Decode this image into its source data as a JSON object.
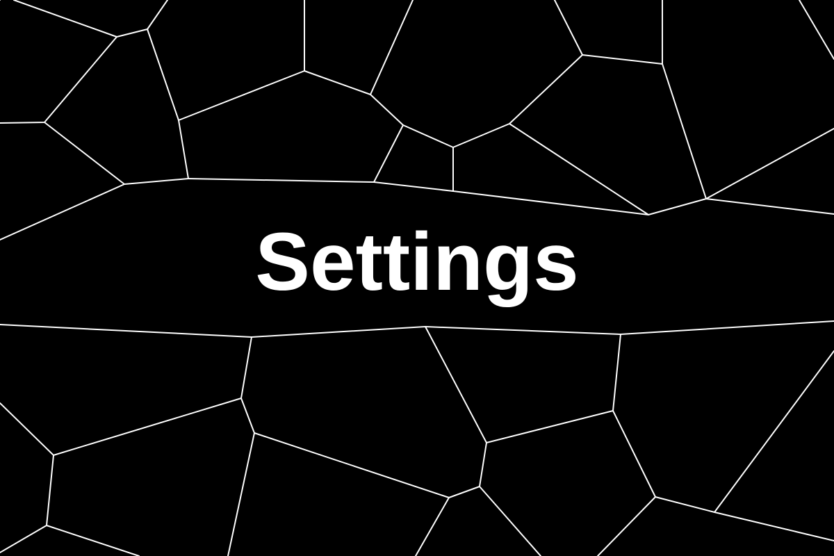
{
  "screen": {
    "title": "Settings",
    "background": "#000000",
    "foreground": "#ffffff",
    "background_pattern": "cracked-voronoi-lines"
  }
}
